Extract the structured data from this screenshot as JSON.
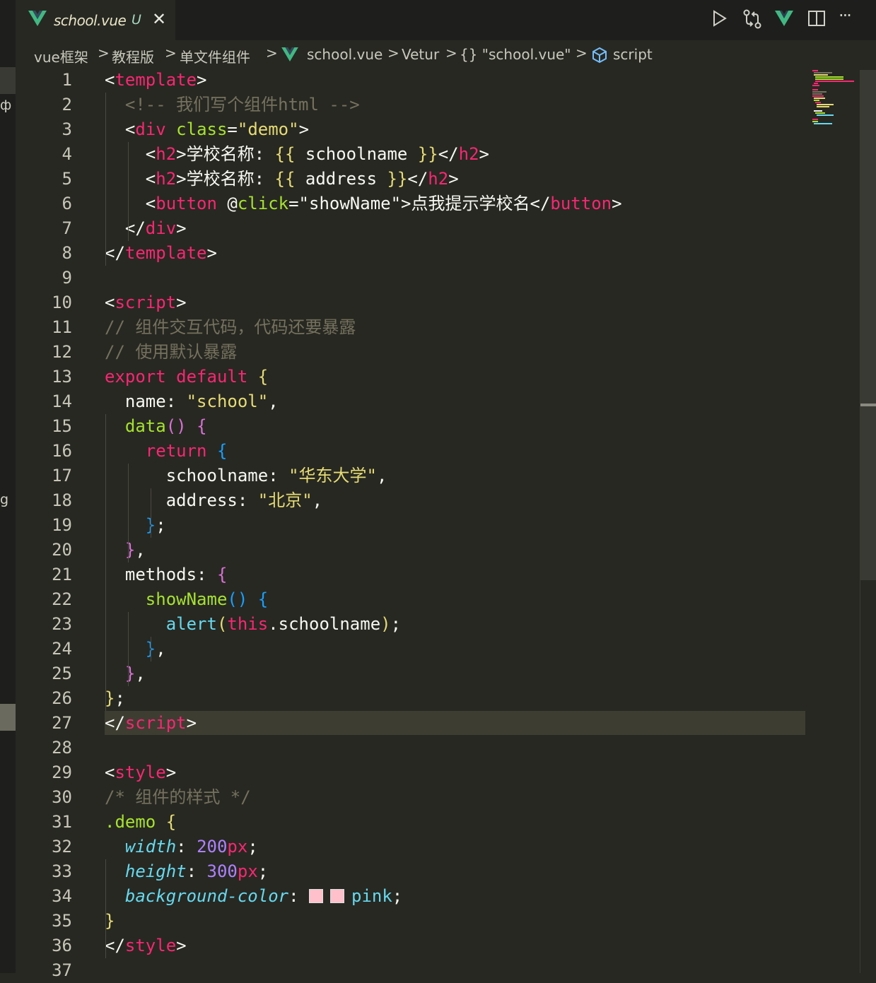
{
  "colors": {
    "background": "#272822",
    "tag_name": "#f92672",
    "keyword": "#f92672",
    "string": "#e6db74",
    "function": "#a6e22e",
    "comment": "#75715e",
    "number": "#ae81ff",
    "property": "#66d9ef",
    "default": "#f8f8f2",
    "vue_logo": "#41b883"
  },
  "left_strip": {
    "fragment_top": "ф",
    "fragment_bottom": "g"
  },
  "tab": {
    "icon": "vue-logo-icon",
    "title": "school.vue",
    "status": "U",
    "close_glyph": "✕"
  },
  "actions": [
    {
      "name": "run-icon",
      "title": "Run"
    },
    {
      "name": "compare-changes-icon",
      "title": "Open Changes"
    },
    {
      "name": "vue-devtools-icon",
      "title": "Vue"
    },
    {
      "name": "split-editor-icon",
      "title": "Split Editor"
    },
    {
      "name": "more-actions-icon",
      "title": "More Actions"
    }
  ],
  "more_glyph": "···",
  "breadcrumb": {
    "items": [
      "vue框架",
      "教程版",
      "单文件组件",
      "school.vue",
      "Vetur",
      "{} \"school.vue\"",
      "script"
    ],
    "separator": ">"
  },
  "editor": {
    "current_line": 27,
    "lines": [
      [
        [
          "<",
          "d"
        ],
        [
          "template",
          "t"
        ],
        [
          ">",
          "d"
        ]
      ],
      [
        [
          "  ",
          ""
        ],
        [
          "<!-- 我们写个组件html -->",
          "c"
        ]
      ],
      [
        [
          "  <",
          "d"
        ],
        [
          "div",
          "t"
        ],
        [
          " ",
          ""
        ],
        [
          "class",
          "f"
        ],
        [
          "=",
          "d"
        ],
        [
          "\"demo\"",
          "s"
        ],
        [
          ">",
          "d"
        ]
      ],
      [
        [
          "    <",
          "d"
        ],
        [
          "h2",
          "t"
        ],
        [
          ">学校名称: ",
          "d"
        ],
        [
          "{{",
          "s"
        ],
        [
          " schoolname ",
          "d"
        ],
        [
          "}}",
          "s"
        ],
        [
          "</",
          "d"
        ],
        [
          "h2",
          "t"
        ],
        [
          ">",
          "d"
        ]
      ],
      [
        [
          "    <",
          "d"
        ],
        [
          "h2",
          "t"
        ],
        [
          ">学校名称: ",
          "d"
        ],
        [
          "{{",
          "s"
        ],
        [
          " address ",
          "d"
        ],
        [
          "}}",
          "s"
        ],
        [
          "</",
          "d"
        ],
        [
          "h2",
          "t"
        ],
        [
          ">",
          "d"
        ]
      ],
      [
        [
          "    <",
          "d"
        ],
        [
          "button",
          "t"
        ],
        [
          " @",
          "d"
        ],
        [
          "click",
          "f"
        ],
        [
          "=\"showName\">点我提示学校名</",
          "d"
        ],
        [
          "button",
          "t"
        ],
        [
          ">",
          "d"
        ]
      ],
      [
        [
          "  </",
          "d"
        ],
        [
          "div",
          "t"
        ],
        [
          ">",
          "d"
        ]
      ],
      [
        [
          "</",
          "d"
        ],
        [
          "template",
          "t"
        ],
        [
          ">",
          "d"
        ]
      ],
      [],
      [
        [
          "<",
          "d"
        ],
        [
          "script",
          "t"
        ],
        [
          ">",
          "d"
        ]
      ],
      [
        [
          "// 组件交互代码，代码还要暴露",
          "c"
        ]
      ],
      [
        [
          "// 使用默认暴露",
          "c"
        ]
      ],
      [
        [
          "export",
          "k"
        ],
        [
          " ",
          ""
        ],
        [
          "default",
          "k"
        ],
        [
          " ",
          ""
        ],
        [
          "{",
          "s"
        ]
      ],
      [
        [
          "  name: ",
          "d"
        ],
        [
          "\"school\"",
          "s"
        ],
        [
          ",",
          "d"
        ]
      ],
      [
        [
          "  ",
          ""
        ],
        [
          "data",
          "f"
        ],
        [
          "()",
          "b1"
        ],
        [
          " ",
          ""
        ],
        [
          "{",
          "b1"
        ]
      ],
      [
        [
          "    ",
          ""
        ],
        [
          "return",
          "k"
        ],
        [
          " ",
          ""
        ],
        [
          "{",
          "b2"
        ]
      ],
      [
        [
          "      schoolname: ",
          "d"
        ],
        [
          "\"华东大学\"",
          "s"
        ],
        [
          ",",
          "d"
        ]
      ],
      [
        [
          "      address: ",
          "d"
        ],
        [
          "\"北京\"",
          "s"
        ],
        [
          ",",
          "d"
        ]
      ],
      [
        [
          "    ",
          ""
        ],
        [
          "}",
          "b2"
        ],
        [
          ";",
          "d"
        ]
      ],
      [
        [
          "  ",
          ""
        ],
        [
          "}",
          "b1"
        ],
        [
          ",",
          "d"
        ]
      ],
      [
        [
          "  methods: ",
          "d"
        ],
        [
          "{",
          "b1"
        ]
      ],
      [
        [
          "    ",
          ""
        ],
        [
          "showName",
          "f"
        ],
        [
          "()",
          "b2"
        ],
        [
          " ",
          ""
        ],
        [
          "{",
          "b2"
        ]
      ],
      [
        [
          "      ",
          ""
        ],
        [
          "alert",
          "p"
        ],
        [
          "(",
          "s"
        ],
        [
          "this",
          "k"
        ],
        [
          ".schoolname",
          "d"
        ],
        [
          ")",
          "s"
        ],
        [
          ";",
          "d"
        ]
      ],
      [
        [
          "    ",
          ""
        ],
        [
          "}",
          "b2"
        ],
        [
          ",",
          "d"
        ]
      ],
      [
        [
          "  ",
          ""
        ],
        [
          "}",
          "b1"
        ],
        [
          ",",
          "d"
        ]
      ],
      [
        [
          "}",
          "s"
        ],
        [
          ";",
          "d"
        ]
      ],
      [
        [
          "</",
          "d"
        ],
        [
          "script",
          "t"
        ],
        [
          ">",
          "d"
        ]
      ],
      [],
      [
        [
          "<",
          "d"
        ],
        [
          "style",
          "t"
        ],
        [
          ">",
          "d"
        ]
      ],
      [
        [
          "/* 组件的样式 */",
          "c"
        ]
      ],
      [
        [
          ".demo",
          "f"
        ],
        [
          " ",
          ""
        ],
        [
          "{",
          "s"
        ]
      ],
      [
        [
          "  ",
          ""
        ],
        [
          "width",
          "pi"
        ],
        [
          ": ",
          "d"
        ],
        [
          "200",
          "n"
        ],
        [
          "px",
          "k"
        ],
        [
          ";",
          "d"
        ]
      ],
      [
        [
          "  ",
          ""
        ],
        [
          "height",
          "pi"
        ],
        [
          ": ",
          "d"
        ],
        [
          "300",
          "n"
        ],
        [
          "px",
          "k"
        ],
        [
          ";",
          "d"
        ]
      ],
      [
        [
          "  ",
          ""
        ],
        [
          "background-color",
          "pi"
        ],
        [
          ": ",
          "d"
        ],
        [
          "SWATCH",
          ""
        ],
        [
          "pink",
          "p"
        ],
        [
          ";",
          "d"
        ]
      ],
      [
        [
          "}",
          "s"
        ]
      ],
      [
        [
          "</",
          "d"
        ],
        [
          "style",
          "t"
        ],
        [
          ">",
          "d"
        ]
      ],
      []
    ]
  }
}
